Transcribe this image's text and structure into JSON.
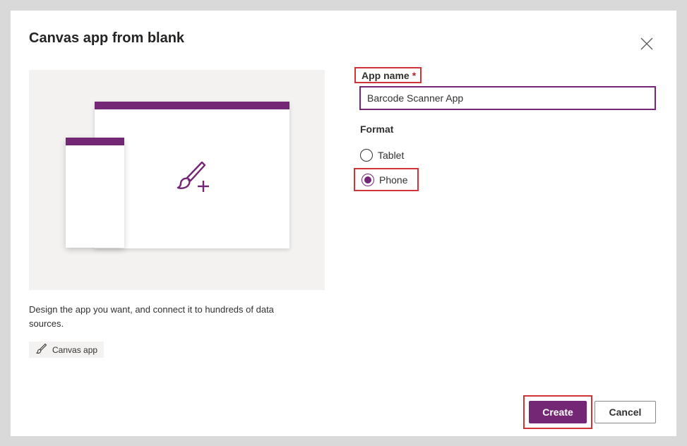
{
  "dialog": {
    "title": "Canvas app from blank",
    "close_icon": "close-icon"
  },
  "preview": {
    "illustration_icon": "brush-plus-icon",
    "description": "Design the app you want, and connect it to hundreds of data sources.",
    "tag_icon": "brush-icon",
    "tag_label": "Canvas app"
  },
  "form": {
    "app_name_label": "App name",
    "required_marker": "*",
    "app_name_value": "Barcode Scanner App",
    "format_label": "Format",
    "format_options": [
      {
        "label": "Tablet",
        "selected": false
      },
      {
        "label": "Phone",
        "selected": true
      }
    ]
  },
  "buttons": {
    "create_label": "Create",
    "cancel_label": "Cancel"
  },
  "colors": {
    "accent": "#742774",
    "highlight": "#d13438",
    "backdrop": "#d9d9d9"
  }
}
